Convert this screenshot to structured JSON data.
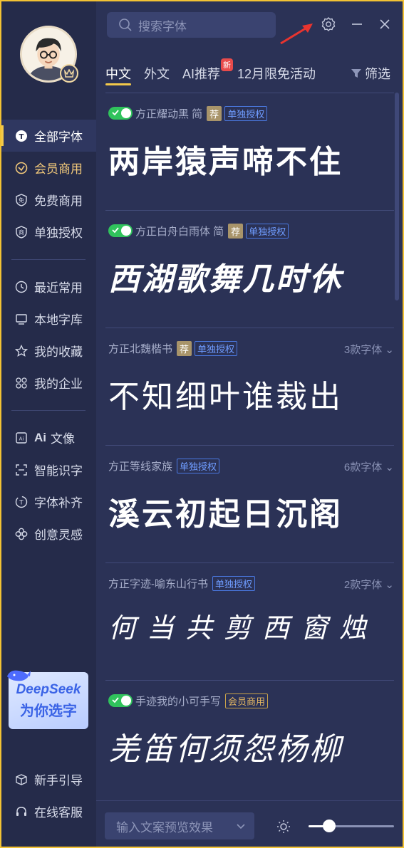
{
  "search": {
    "placeholder": "搜索字体"
  },
  "tabs": [
    {
      "label": "中文",
      "active": true
    },
    {
      "label": "外文"
    },
    {
      "label": "AI推荐",
      "badge": "新"
    },
    {
      "label": "12月限免活动"
    }
  ],
  "filter_label": "筛选",
  "sidebar": {
    "items": [
      {
        "label": "全部字体",
        "icon": "t-circle-icon"
      },
      {
        "label": "会员商用",
        "icon": "vip-circle-icon"
      },
      {
        "label": "免费商用",
        "icon": "free-shield-icon"
      },
      {
        "label": "单独授权",
        "icon": "license-shield-icon"
      },
      {
        "label": "最近常用",
        "icon": "clock-icon"
      },
      {
        "label": "本地字库",
        "icon": "monitor-icon"
      },
      {
        "label": "我的收藏",
        "icon": "star-icon"
      },
      {
        "label": "我的企业",
        "icon": "grid-icon"
      },
      {
        "label": "文像",
        "prefix": "Ai",
        "icon": "ai-image-icon"
      },
      {
        "label": "智能识字",
        "icon": "scan-icon"
      },
      {
        "label": "字体补齐",
        "icon": "font-fill-icon"
      },
      {
        "label": "创意灵感",
        "icon": "flower-icon"
      },
      {
        "label": "新手引导",
        "icon": "box-icon"
      },
      {
        "label": "在线客服",
        "icon": "headset-icon"
      }
    ]
  },
  "deepseek": {
    "title": "DeepSeek",
    "subtitle": "为你选字"
  },
  "fonts": [
    {
      "name": "方正耀动黑 简",
      "recommended": "荐",
      "license": "单独授权",
      "preview": "两岸猿声啼不住",
      "installed": true
    },
    {
      "name": "方正白舟白雨体 简",
      "recommended": "荐",
      "license": "单独授权",
      "preview": "西湖歌舞几时休",
      "installed": true
    },
    {
      "name": "方正北魏楷书",
      "recommended": "荐",
      "license": "单独授权",
      "preview": "不知细叶谁裁出",
      "variants": "3款字体"
    },
    {
      "name": "方正等线家族",
      "license": "单独授权",
      "preview": "溪云初起日沉阁",
      "variants": "6款字体"
    },
    {
      "name": "方正字迹-喻东山行书",
      "license": "单独授权",
      "preview": "何当共剪西窗烛",
      "variants": "2款字体"
    },
    {
      "name": "手迹我的小可手写",
      "license": "会员商用",
      "preview": "羌笛何须怨杨柳",
      "installed": true
    }
  ],
  "bottom": {
    "preview_placeholder": "输入文案预览效果",
    "size_level": 0.24
  },
  "colors": {
    "accent": "#f3c94a",
    "toggle_on": "#30c35c",
    "license_blue": "#4a78e0",
    "vip_gold": "#c9a24a"
  }
}
